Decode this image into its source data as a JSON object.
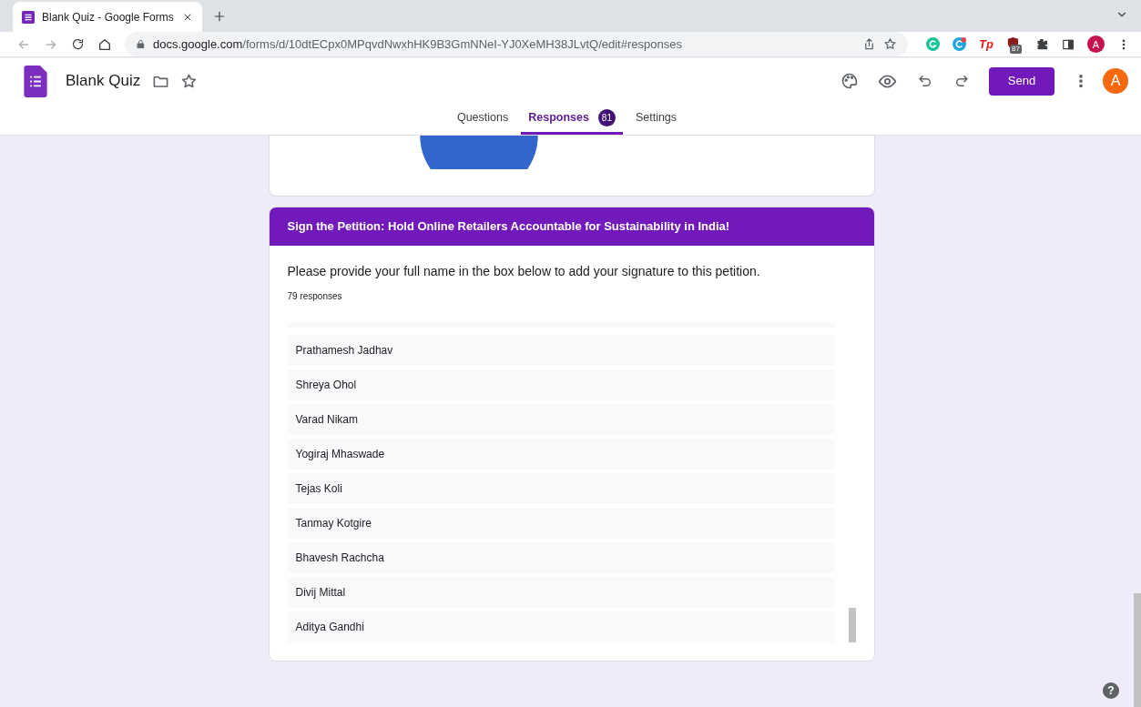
{
  "browser": {
    "tab_title": "Blank Quiz - Google Forms",
    "url_host": "docs.google.com",
    "url_path": "/forms/d/10dtECpx0MPqvdNwxhHK9B3GmNNeI-YJ0XeMH38JLvtQ/edit#responses",
    "extension_text": "Tp",
    "extension_badge": "87",
    "profile_letter": "A"
  },
  "header": {
    "title": "Blank Quiz",
    "send_label": "Send",
    "avatar_letter": "A"
  },
  "tabs": [
    {
      "label": "Questions",
      "selected": false
    },
    {
      "label": "Responses",
      "selected": true,
      "badge": "81"
    },
    {
      "label": "Settings",
      "selected": false
    }
  ],
  "section": {
    "title": "Sign the Petition: Hold Online Retailers Accountable for Sustainability in India!",
    "question": "Please provide your full name in the box below to add your signature to this petition.",
    "responses": "79 responses",
    "answers": [
      "Prathamesh Jadhav",
      "Shreya Ohol",
      "Varad Nikam",
      "Yogiraj Mhaswade",
      "Tejas Koli",
      "Tanmay Kotgire",
      "Bhavesh Rachcha",
      "Divij Mittal",
      "Aditya Gandhi"
    ]
  },
  "help_label": "?"
}
